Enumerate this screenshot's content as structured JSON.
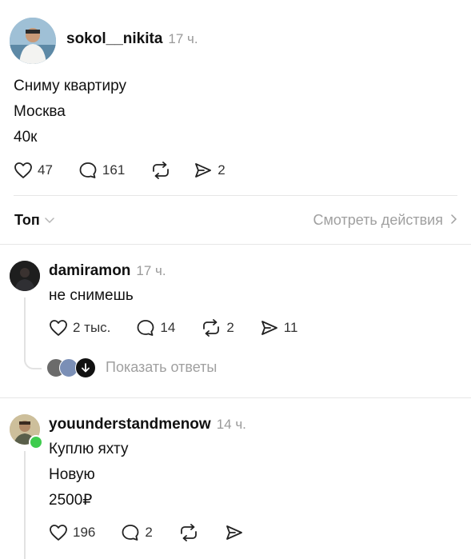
{
  "post": {
    "username": "sokol__nikita",
    "time": "17 ч.",
    "lines": [
      "Сниму квартиру",
      "Москва",
      "40к"
    ],
    "likes": "47",
    "replies": "161",
    "shares": "2"
  },
  "sort": {
    "label": "Топ",
    "activity_link": "Смотреть действия"
  },
  "comments": [
    {
      "username": "damiramon",
      "time": "17 ч.",
      "lines": [
        "не снимешь"
      ],
      "likes": "2 тыс.",
      "replies": "14",
      "reposts": "2",
      "shares": "11",
      "show_replies": "Показать ответы"
    },
    {
      "username": "youunderstandmenow",
      "time": "14 ч.",
      "lines": [
        "Куплю яхту",
        "Новую",
        "2500₽"
      ],
      "likes": "196",
      "replies": "2"
    }
  ],
  "colors": {
    "online": "#3fcc4e",
    "muted": "#9a9a9a",
    "divider": "#e6e6e6"
  }
}
